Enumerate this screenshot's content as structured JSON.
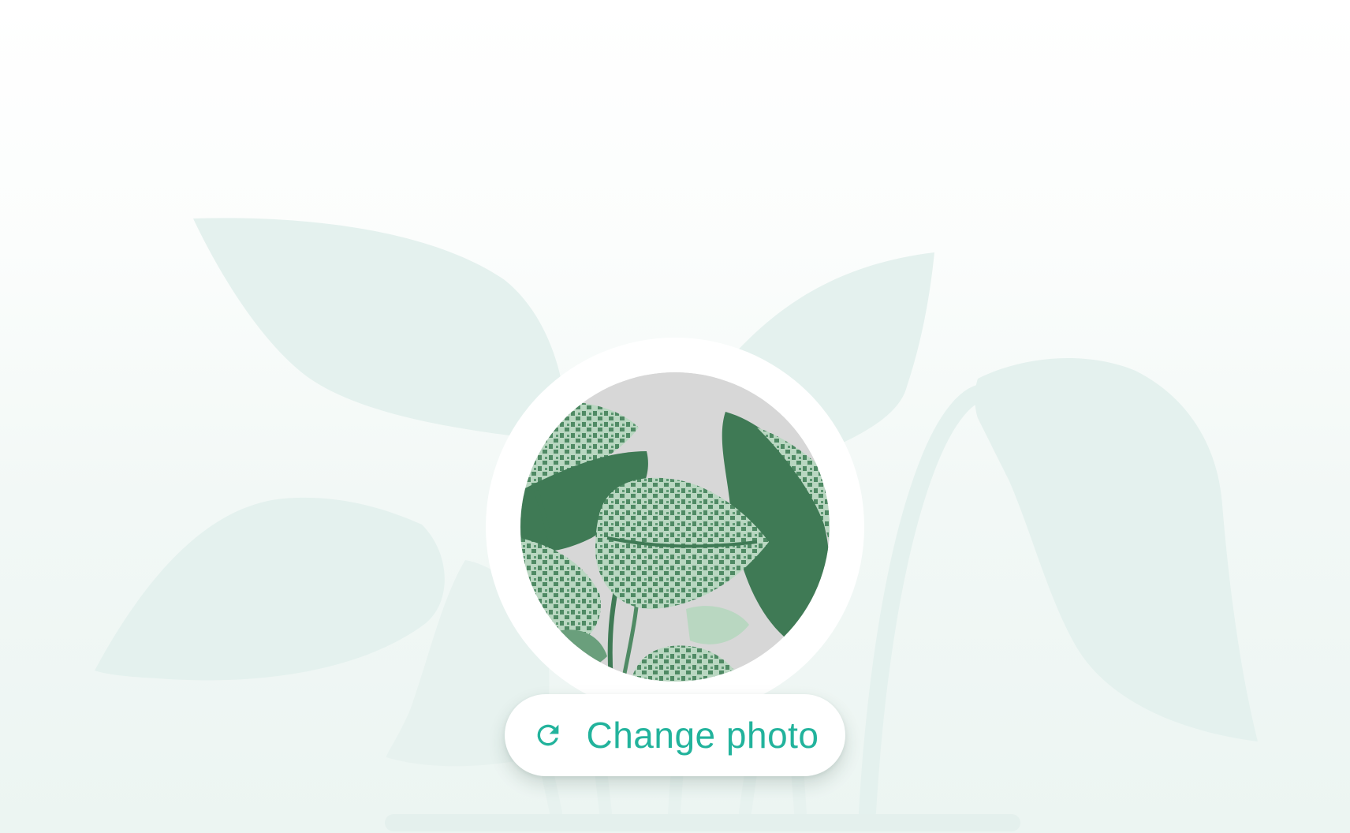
{
  "change_photo": {
    "label": "Change photo",
    "icon": "refresh-icon"
  },
  "profile_photo": {
    "subject": "plant-photo"
  },
  "colors": {
    "accent": "#22b39c",
    "background_leaf": "#e4f1ee",
    "leaf_dark": "#3f7a55",
    "leaf_light": "#b9d7c1",
    "photo_background": "#d7d7d7"
  }
}
